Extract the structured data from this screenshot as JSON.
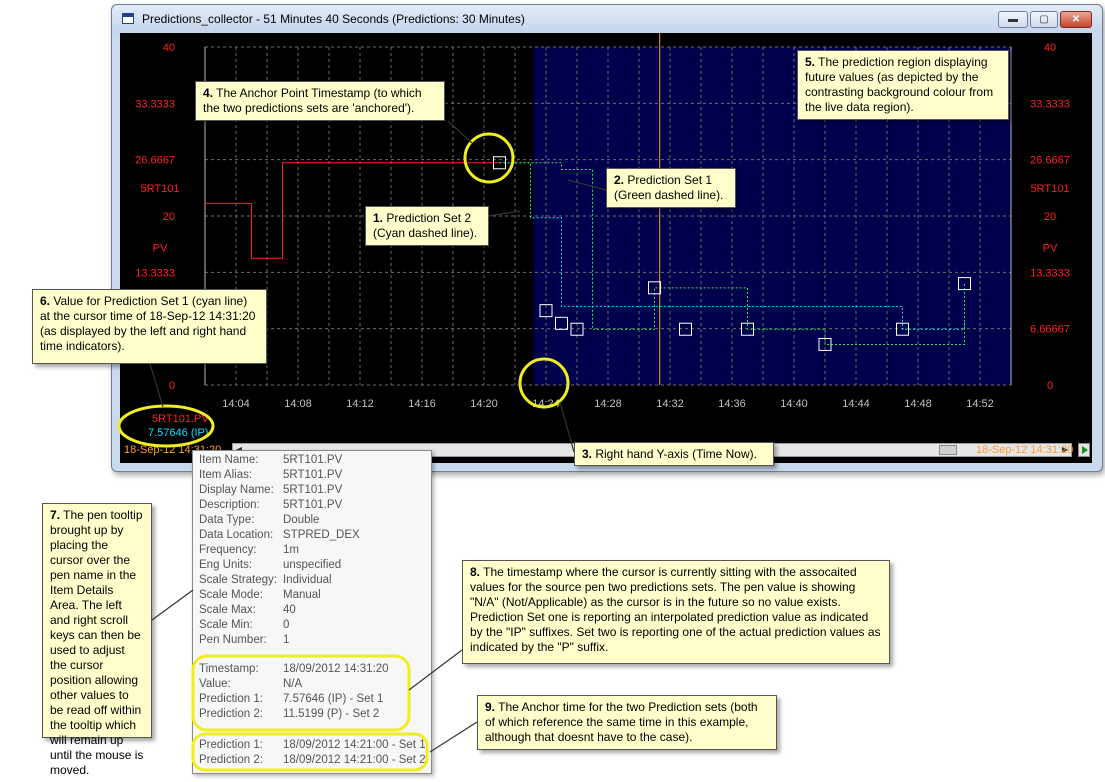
{
  "window": {
    "title": "Predictions_collector - 51 Minutes 40 Seconds  (Predictions: 30 Minutes)",
    "min_label": "▬",
    "max_label": "▢",
    "close_label": "✕"
  },
  "chart_data": {
    "type": "line",
    "background": "#000000",
    "prediction_background": "#00004d",
    "grid": true,
    "left_axis_ticks": [
      "40",
      "33.3333",
      "26.6667",
      "20",
      "13.3333",
      "0"
    ],
    "right_axis_ticks": [
      "40",
      "33.3333",
      "26.6667",
      "20",
      "13.3333",
      "6.66667",
      "0"
    ],
    "axis_pen_label_1": "5RT101",
    "axis_pen_label_2": "PV",
    "ylim": [
      0,
      40
    ],
    "x_ticks": [
      "14:04",
      "14:08",
      "14:12",
      "14:16",
      "14:20",
      "14:24",
      "14:28",
      "14:32",
      "14:36",
      "14:40",
      "14:44",
      "14:48",
      "14:52"
    ],
    "xlim": [
      "14:02",
      "14:54"
    ],
    "anchor_time": "14:21",
    "cursor_time": "14:31:20",
    "series": [
      {
        "name": "5RT101.PV",
        "color": "#ff2020",
        "style": "solid",
        "x": [
          "14:02",
          "14:05",
          "14:05",
          "14:07",
          "14:07",
          "14:09",
          "14:21"
        ],
        "y": [
          21.5,
          21.5,
          15.0,
          15.0,
          26.3,
          26.3,
          26.3
        ]
      },
      {
        "name": "",
        "color": "#00e5ff",
        "style": "dashed",
        "x": [
          "14:21",
          "14:23",
          "14:23",
          "14:25",
          "14:25",
          "14:47",
          "14:47",
          "14:51",
          "14:51"
        ],
        "y": [
          26.3,
          26.3,
          19.8,
          19.8,
          9.3,
          9.3,
          6.6,
          6.6,
          7.6
        ]
      },
      {
        "name": "",
        "color": "#22ee44",
        "style": "dashed",
        "x": [
          "14:21",
          "14:25",
          "14:25",
          "14:27",
          "14:27",
          "14:31",
          "14:31",
          "14:37",
          "14:37",
          "14:42",
          "14:42",
          "14:51",
          "14:51"
        ],
        "y": [
          26.3,
          26.3,
          25.5,
          25.5,
          6.6,
          6.6,
          11.5,
          11.5,
          6.6,
          6.6,
          4.8,
          4.8,
          12.0
        ]
      }
    ],
    "markers": [
      {
        "x": "14:21",
        "y": 26.3
      },
      {
        "x": "14:24",
        "y": 8.8
      },
      {
        "x": "14:25",
        "y": 7.3
      },
      {
        "x": "14:26",
        "y": 6.6
      },
      {
        "x": "14:31",
        "y": 11.5
      },
      {
        "x": "14:33",
        "y": 6.6
      },
      {
        "x": "14:37",
        "y": 6.6
      },
      {
        "x": "14:42",
        "y": 4.8
      },
      {
        "x": "14:47",
        "y": 6.6
      },
      {
        "x": "14:51",
        "y": 12.0
      }
    ]
  },
  "item_details": {
    "pen_name": "5RT101.PV",
    "pen_value": "7.57646 (IP)",
    "timestamp_left": "18-Sep-12 14:31:20",
    "timestamp_right": "18-Sep-12 14:31:20"
  },
  "tooltip": {
    "rows": [
      {
        "label": "Item Name:",
        "value": "5RT101.PV"
      },
      {
        "label": "Item Alias:",
        "value": "5RT101.PV"
      },
      {
        "label": "Display Name:",
        "value": "5RT101.PV"
      },
      {
        "label": "Description:",
        "value": "5RT101.PV"
      },
      {
        "label": "Data Type:",
        "value": "Double"
      },
      {
        "label": "Data Location:",
        "value": "STPRED_DEX"
      },
      {
        "label": "Frequency:",
        "value": "1m"
      },
      {
        "label": "Eng Units:",
        "value": "unspecified"
      },
      {
        "label": "Scale Strategy:",
        "value": "Individual"
      },
      {
        "label": "Scale Mode:",
        "value": "Manual"
      },
      {
        "label": "Scale Max:",
        "value": "40"
      },
      {
        "label": "Scale Min:",
        "value": "0"
      },
      {
        "label": "Pen Number:",
        "value": "1"
      }
    ],
    "values": [
      {
        "label": "Timestamp:",
        "value": "18/09/2012 14:31:20"
      },
      {
        "label": "Value:",
        "value": "N/A"
      },
      {
        "label": "Prediction 1:",
        "value": "7.57646 (IP)  - Set 1"
      },
      {
        "label": "Prediction 2:",
        "value": "11.5199 (P)  - Set 2"
      }
    ],
    "anchors": [
      {
        "label": "Prediction 1:",
        "value": "18/09/2012 14:21:00 - Set 1"
      },
      {
        "label": "Prediction 2:",
        "value": "18/09/2012 14:21:00 - Set 2"
      }
    ]
  },
  "callouts": {
    "c1": {
      "num": "1.",
      "text": " Prediction Set 2 (Cyan dashed line)."
    },
    "c2": {
      "num": "2.",
      "text": " Prediction Set 1 (Green dashed line)."
    },
    "c3": {
      "num": "3.",
      "text": " Right hand Y-axis (Time Now)."
    },
    "c4": {
      "num": "4.",
      "text": " The Anchor Point Timestamp (to which the two predictions sets are 'anchored')."
    },
    "c5": {
      "num": "5.",
      "text": " The prediction region displaying future values (as depicted by the contrasting background colour from the live data region)."
    },
    "c6": {
      "num": "6.",
      "text": " Value for Prediction Set 1 (cyan line) at the cursor time of 18-Sep-12 14:31:20 (as displayed by the left and right hand time indicators)."
    },
    "c7": {
      "num": "7.",
      "text": " The pen tooltip brought up by placing the cursor over the pen name in the Item Details Area.  The left and right scroll keys can then be used to adjust the cursor position allowing other values to be read off within the tooltip which will remain up until the mouse is moved."
    },
    "c8": {
      "num": "8.",
      "text": " The timestamp where the cursor is currently sitting with the assocaited values for the source pen two predictions sets.  The pen value is showing \"N/A\" (Not/Applicable) as the cursor is in the future so no value exists.  Prediction Set one is reporting an interpolated prediction value as indicated by the \"IP\" suffixes.  Set two is reporting one of the actual prediction values as indicated by the \"P\" suffix."
    },
    "c9": {
      "num": "9.",
      "text": " The Anchor time for the two Prediction sets (both of which reference the same time in this example, although that doesnt have to the case)."
    }
  },
  "colors": {
    "axis_text": "#ff2020",
    "time_text": "#ff9b30",
    "highlight": "#eeee20",
    "callout_bg": "#ffffcc"
  }
}
